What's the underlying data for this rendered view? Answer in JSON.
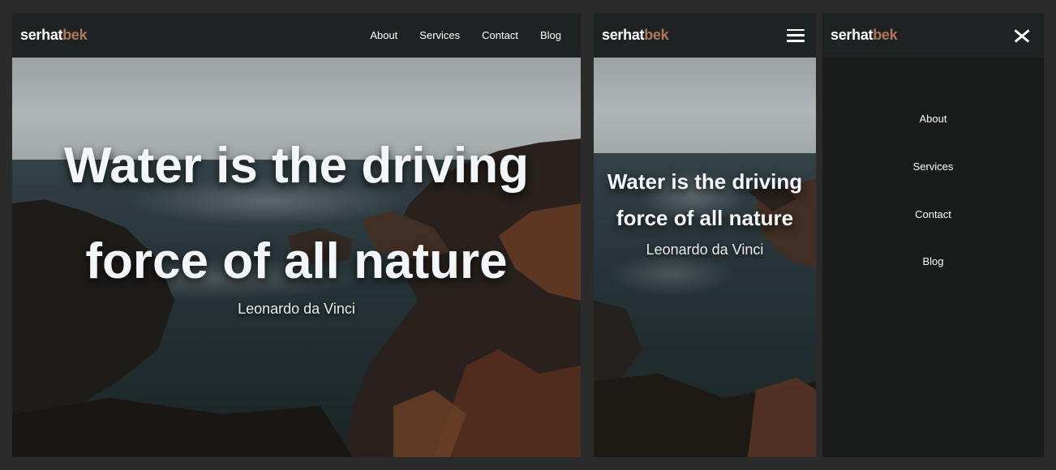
{
  "brand": {
    "part1": "serhat",
    "part2": "bek"
  },
  "nav": {
    "items": [
      {
        "label": "About"
      },
      {
        "label": "Services"
      },
      {
        "label": "Contact"
      },
      {
        "label": "Blog"
      }
    ]
  },
  "hero": {
    "quote_line1": "Water is the driving",
    "quote_line2": "force of all nature",
    "author": "Leonardo da Vinci"
  },
  "icons": {
    "menu": "hamburger-icon",
    "close": "close-icon"
  },
  "colors": {
    "background": "#2b2b2b",
    "navbar": "#1e2222",
    "brand_accent": "#b0765a",
    "menu_background": "#1a1b1b"
  }
}
